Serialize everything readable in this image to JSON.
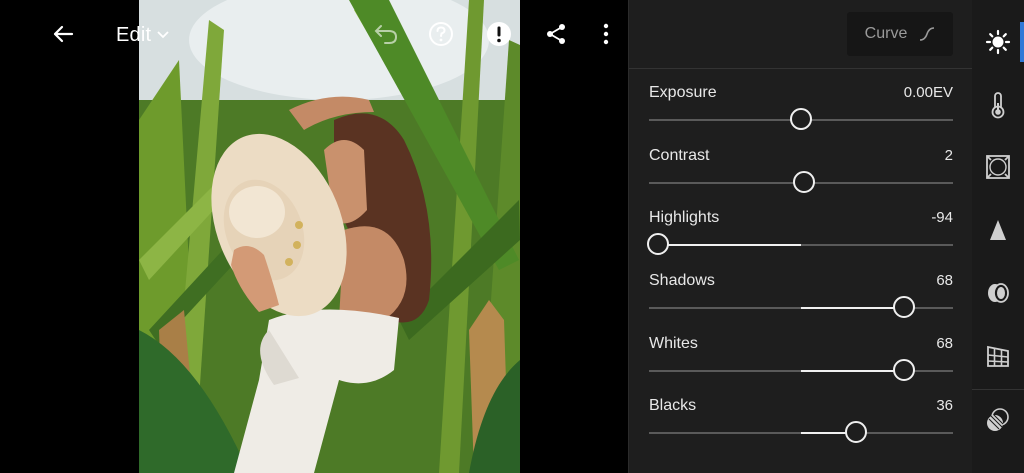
{
  "toolbar": {
    "edit_label": "Edit"
  },
  "panel": {
    "curve_label": "Curve",
    "sliders": [
      {
        "name": "Exposure",
        "value_text": "0.00EV",
        "value": 0,
        "min": -5,
        "max": 5,
        "bipolar": true
      },
      {
        "name": "Contrast",
        "value_text": "2",
        "value": 2,
        "min": -100,
        "max": 100,
        "bipolar": true
      },
      {
        "name": "Highlights",
        "value_text": "-94",
        "value": -94,
        "min": -100,
        "max": 100,
        "bipolar": true
      },
      {
        "name": "Shadows",
        "value_text": "68",
        "value": 68,
        "min": -100,
        "max": 100,
        "bipolar": true
      },
      {
        "name": "Whites",
        "value_text": "68",
        "value": 68,
        "min": -100,
        "max": 100,
        "bipolar": true
      },
      {
        "name": "Blacks",
        "value_text": "36",
        "value": 36,
        "min": -100,
        "max": 100,
        "bipolar": true
      }
    ]
  },
  "rail": {
    "tools": [
      "light-icon",
      "color-icon",
      "effects-icon",
      "detail-icon",
      "optics-icon",
      "geometry-icon",
      "masking-icon"
    ],
    "active": "light-icon"
  },
  "colors": {
    "accent": "#2f78d7",
    "panel_bg": "#1e1e1e",
    "track": "#5a5a5a",
    "fill": "#f0f0f0"
  }
}
